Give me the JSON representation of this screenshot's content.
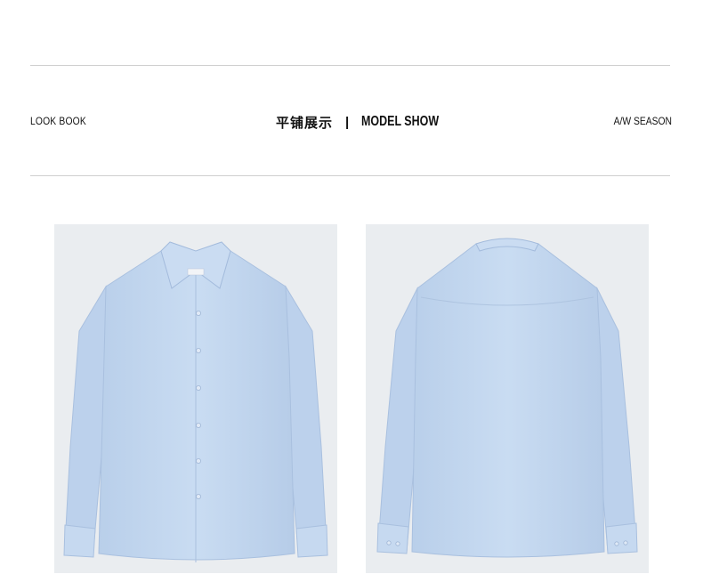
{
  "header": {
    "left_label": "LOOK BOOK",
    "title_cn": "平铺展示",
    "separator": "|",
    "title_en": "MODEL SHOW",
    "right_label": "A/W SEASON"
  },
  "photos": [
    {
      "view": "front"
    },
    {
      "view": "back"
    }
  ],
  "colors": {
    "shirt": "#c3d7ef",
    "background": "#eaedf0",
    "rule": "#cfcfcf"
  }
}
